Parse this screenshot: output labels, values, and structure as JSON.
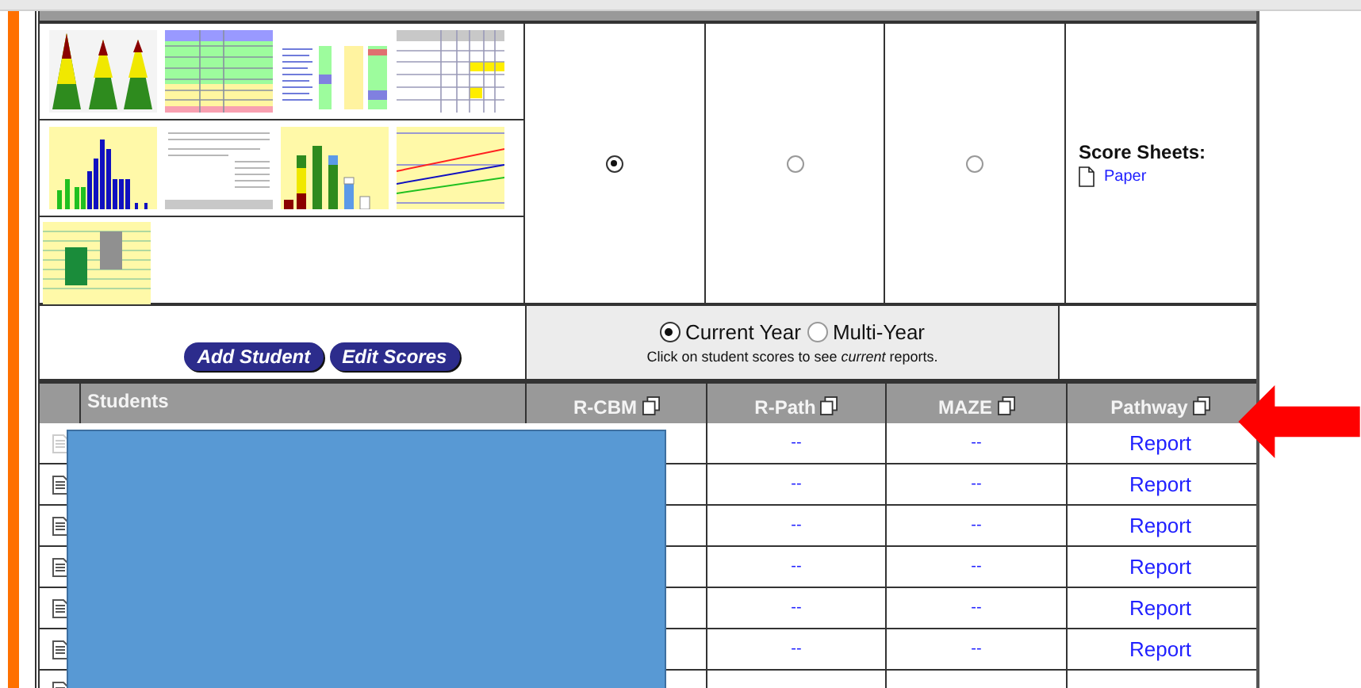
{
  "thumbnails": [
    {
      "kind": "pyramid"
    },
    {
      "kind": "table"
    },
    {
      "kind": "heatmap"
    },
    {
      "kind": "grid"
    },
    {
      "kind": "histogram"
    },
    {
      "kind": "report"
    },
    {
      "kind": "bars"
    },
    {
      "kind": "lines"
    },
    {
      "kind": "boxes"
    }
  ],
  "report_options": [
    {
      "selected": true
    },
    {
      "selected": false
    },
    {
      "selected": false
    }
  ],
  "score_sheets": {
    "label": "Score Sheets:",
    "link": "Paper"
  },
  "buttons": [
    "Add Student",
    "Edit Scores"
  ],
  "year_options": [
    {
      "label": "Current Year",
      "selected": true
    },
    {
      "label": "Multi-Year",
      "selected": false
    }
  ],
  "hint": "Click on student scores to see *current* reports.",
  "columns": [
    "Students",
    "R-CBM",
    "R-Path",
    "MAZE",
    "Pathway"
  ],
  "rows": [
    {
      "disabled": true,
      "r_path": "--",
      "maze": "--",
      "pathway": "Report"
    },
    {
      "disabled": false,
      "r_path": "--",
      "maze": "--",
      "pathway": "Report"
    },
    {
      "disabled": false,
      "r_path": "--",
      "maze": "--",
      "pathway": "Report"
    },
    {
      "disabled": false,
      "r_path": "--",
      "maze": "--",
      "pathway": "Report"
    },
    {
      "disabled": false,
      "r_path": "--",
      "maze": "--",
      "pathway": "Report"
    },
    {
      "disabled": false,
      "r_path": "--",
      "maze": "--",
      "pathway": "Report"
    },
    {
      "disabled": false,
      "r_path": "",
      "maze": "",
      "pathway": ""
    }
  ]
}
